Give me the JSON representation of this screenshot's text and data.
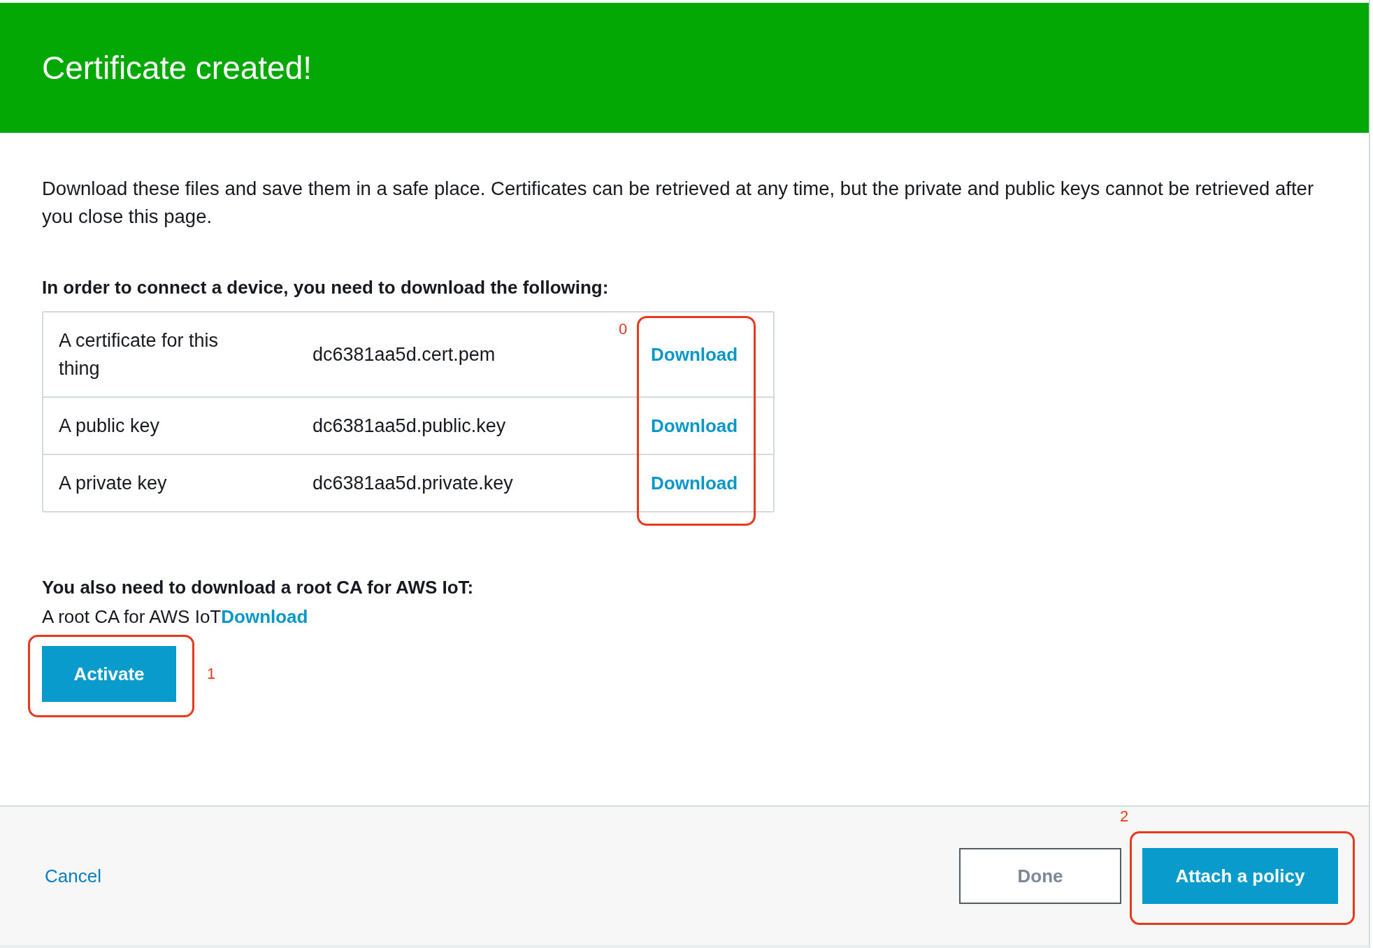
{
  "header": {
    "title": "Certificate created!"
  },
  "intro": "Download these files and save them in a safe place. Certificates can be retrieved at any time, but the private and public keys cannot be retrieved after you close this page.",
  "files_heading": "In order to connect a device, you need to download the following:",
  "files": [
    {
      "label": "A certificate for this thing",
      "file": "dc6381aa5d.cert.pem",
      "action": "Download"
    },
    {
      "label": "A public key",
      "file": "dc6381aa5d.public.key",
      "action": "Download"
    },
    {
      "label": "A private key",
      "file": "dc6381aa5d.private.key",
      "action": "Download"
    }
  ],
  "root_ca": {
    "heading": "You also need to download a root CA for AWS IoT:",
    "label": "A root CA for AWS IoT",
    "action": "Download"
  },
  "downloads_annotation": "0",
  "activate": {
    "label": "Activate",
    "annotation": "1"
  },
  "footer": {
    "cancel": "Cancel",
    "done": "Done",
    "attach": {
      "label": "Attach a policy",
      "annotation": "2"
    }
  }
}
